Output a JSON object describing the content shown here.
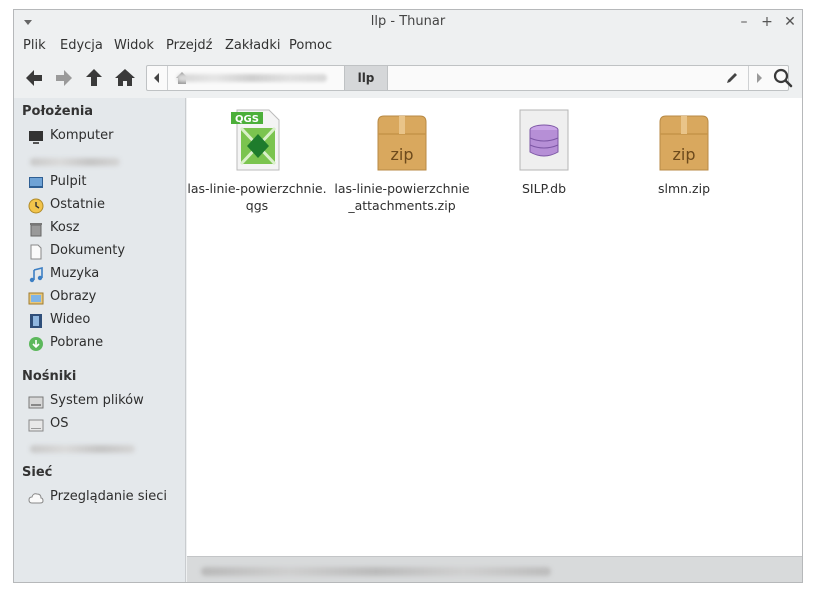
{
  "window": {
    "title": "llp - Thunar",
    "controls": [
      "minimize-icon",
      "maximize-icon",
      "close-icon"
    ]
  },
  "menubar": {
    "items": [
      "Plik",
      "Edycja",
      "Widok",
      "Przejdź",
      "Zakładki",
      "Pomoc"
    ]
  },
  "toolbar": {
    "buttons": [
      "back-arrow-icon",
      "forward-arrow-icon",
      "up-arrow-icon",
      "home-icon"
    ],
    "path": {
      "current": "llp"
    }
  },
  "sidebar": {
    "places_heading": "Położenia",
    "places": [
      {
        "label": "Komputer",
        "icon": "computer-icon"
      },
      {
        "label": "Pulpit",
        "icon": "desktop-icon"
      },
      {
        "label": "Ostatnie",
        "icon": "recent-icon"
      },
      {
        "label": "Kosz",
        "icon": "trash-icon"
      },
      {
        "label": "Dokumenty",
        "icon": "document-icon"
      },
      {
        "label": "Muzyka",
        "icon": "music-icon"
      },
      {
        "label": "Obrazy",
        "icon": "pictures-icon"
      },
      {
        "label": "Wideo",
        "icon": "video-icon"
      },
      {
        "label": "Pobrane",
        "icon": "download-icon"
      }
    ],
    "devices_heading": "Nośniki",
    "devices": [
      {
        "label": "System plików",
        "icon": "drive-icon"
      },
      {
        "label": "OS",
        "icon": "drive-icon"
      }
    ],
    "network_heading": "Sieć",
    "network": [
      {
        "label": "Przeglądanie sieci",
        "icon": "network-cloud-icon"
      }
    ]
  },
  "files": [
    {
      "name": "las-linie-powierzchnie.qgs",
      "icon": "qgs-file-icon",
      "badge": "QGS"
    },
    {
      "name": "las-linie-powierzchnie_attachments.zip",
      "icon": "zip-archive-icon",
      "badge": "zip"
    },
    {
      "name": "SILP.db",
      "icon": "database-file-icon"
    },
    {
      "name": "slmn.zip",
      "icon": "zip-archive-icon",
      "badge": "zip"
    }
  ],
  "colors": {
    "window_bg": "#eef0f1",
    "sidebar_bg": "#e4e8eb",
    "content_bg": "#ffffff",
    "zip_box": "#d9a85e",
    "qgs_green": "#4caf3a",
    "db_purple": "#b68fd6"
  }
}
